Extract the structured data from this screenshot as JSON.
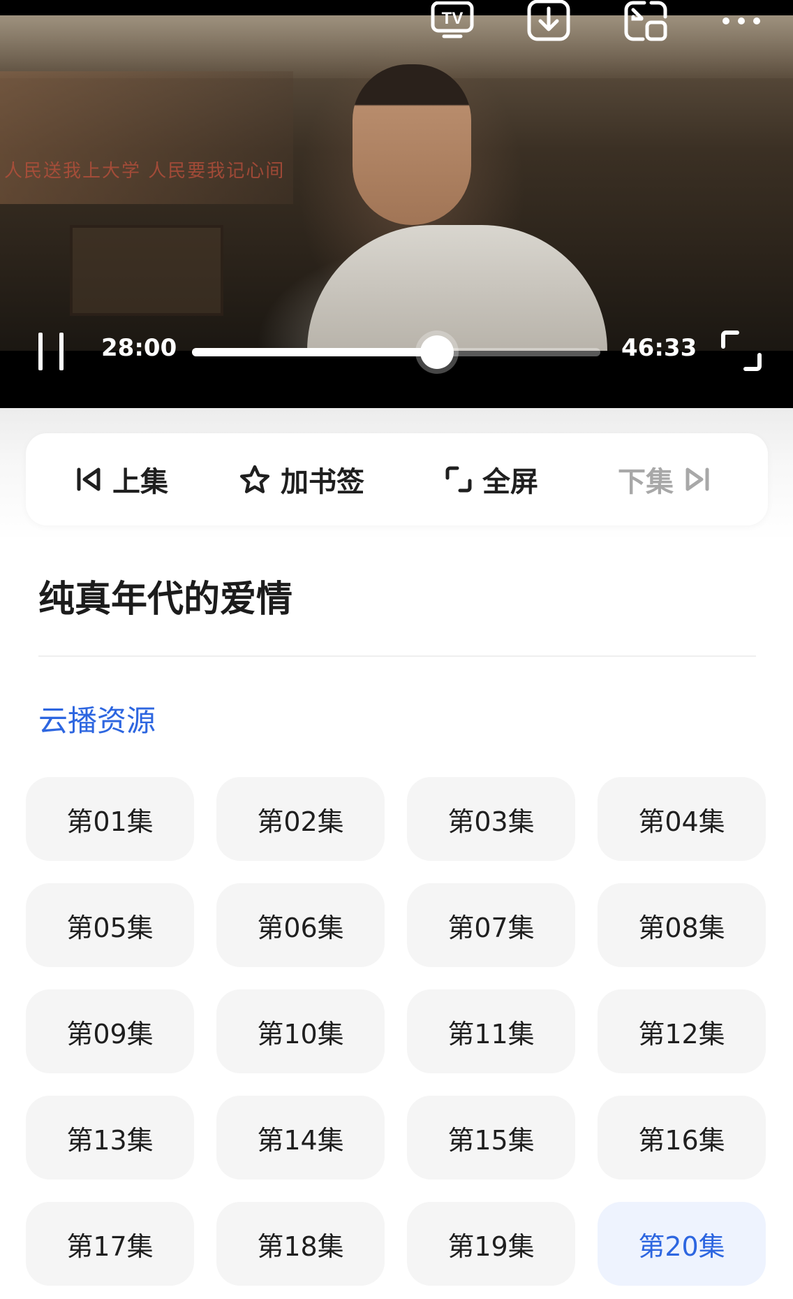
{
  "player": {
    "top_icons": [
      "tv-cast-icon",
      "download-icon",
      "picture-in-picture-icon",
      "more-icon"
    ],
    "poster_text": "人民送我上大学 人民要我记心间",
    "current_time": "28:00",
    "total_time": "46:33",
    "progress_fraction": 0.6,
    "state": "playing"
  },
  "actions": {
    "prev_label": "上集",
    "bookmark_label": "加书签",
    "fullscreen_label": "全屏",
    "next_label": "下集"
  },
  "show": {
    "title": "纯真年代的爱情",
    "source_label": "云播资源"
  },
  "colors": {
    "accent": "#2d66e0",
    "episode_bg": "#f5f5f5",
    "episode_active_bg": "#eef3fe"
  },
  "episodes": [
    {
      "label": "第01集"
    },
    {
      "label": "第02集"
    },
    {
      "label": "第03集"
    },
    {
      "label": "第04集"
    },
    {
      "label": "第05集"
    },
    {
      "label": "第06集"
    },
    {
      "label": "第07集"
    },
    {
      "label": "第08集"
    },
    {
      "label": "第09集"
    },
    {
      "label": "第10集"
    },
    {
      "label": "第11集"
    },
    {
      "label": "第12集"
    },
    {
      "label": "第13集"
    },
    {
      "label": "第14集"
    },
    {
      "label": "第15集"
    },
    {
      "label": "第16集"
    },
    {
      "label": "第17集"
    },
    {
      "label": "第18集"
    },
    {
      "label": "第19集"
    },
    {
      "label": "第20集",
      "active": true
    }
  ]
}
